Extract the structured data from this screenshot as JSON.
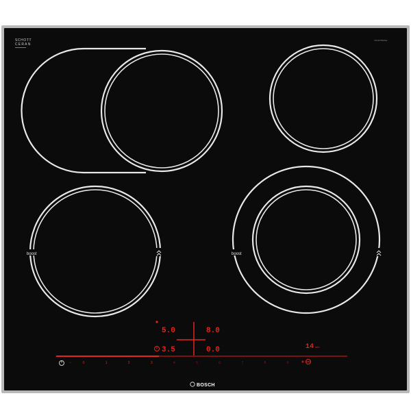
{
  "brand": {
    "glass_logo_line1": "SCHOTT",
    "glass_logo_line2": "CERAN",
    "manufacturer": "BOSCH",
    "model_code": "PKN675DP1E"
  },
  "zones": {
    "front_left_boost_label": "boost",
    "front_right_boost_label": "boost"
  },
  "display": {
    "row1_left": "5.0",
    "row1_right": "8.0",
    "row2_left": "3.5",
    "row2_right": "0.0",
    "timer": "14",
    "timer_unit": "min"
  },
  "slider": {
    "labels": [
      "0",
      "1",
      "2",
      "3",
      "4",
      "5",
      "6",
      "7",
      "8",
      "9"
    ]
  },
  "colors": {
    "glass": "#0b0b0b",
    "frame": "#b9b9b9",
    "zone_line": "#e8e8e8",
    "display_red": "#e8241f",
    "dim_red": "#7a1410"
  },
  "icons": [
    "power-icon",
    "child-lock-icon",
    "boost-chevron-icon",
    "timer-icon",
    "plus-icon",
    "minus-icon"
  ]
}
